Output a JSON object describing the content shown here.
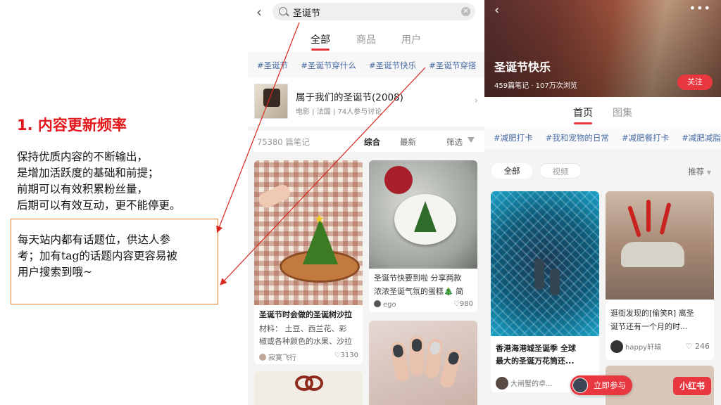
{
  "slide": {
    "heading": "1. 内容更新频率",
    "body": [
      "保持优质内容的不断输出，",
      "是增加活跃度的基础和前提；",
      "前期可以有效积累粉丝量，",
      "后期可以有效互动，更不能停更。"
    ],
    "callout": [
      "每天站内都有话题位，供达人参",
      "考；加有tag的话题内容更容易被",
      "用户搜索到哦~"
    ]
  },
  "search_screen": {
    "query": "圣诞节",
    "tabs": [
      {
        "label": "全部",
        "active": true
      },
      {
        "label": "商品",
        "active": false
      },
      {
        "label": "用户",
        "active": false
      }
    ],
    "hashtags": [
      "#圣诞节",
      "#圣诞节穿什么",
      "#圣诞节快乐",
      "#圣诞节穿搭"
    ],
    "topic": {
      "title": "属于我们的圣诞节(2008)",
      "meta": "电影 | 法国 | 74人参与讨论"
    },
    "note_count": "75380 篇笔记",
    "sort_options": [
      "综合",
      "最新"
    ],
    "filter_label": "筛选",
    "cards": [
      {
        "title": "圣诞节时会做的圣诞树沙拉",
        "desc_line1": "材料：  土豆、西兰花、彩",
        "desc_line2": "椒或各种颜色的水果、沙拉",
        "author": "寂寞飞行",
        "likes": "3130"
      },
      {
        "title_line1": "圣诞节快要到啦 分享两款",
        "title_line2": "浓浓圣诞气氛的蛋糕🎄 简",
        "author": "ego",
        "likes": "980"
      }
    ]
  },
  "topic_screen": {
    "title": "圣诞节快乐",
    "meta": "459篇笔记 · 107万次浏览",
    "follow_label": "关注",
    "tabs": [
      {
        "label": "首页",
        "active": true
      },
      {
        "label": "图集",
        "active": false
      }
    ],
    "hashtags": [
      "#减肥打卡",
      "#我和宠物的日常",
      "#减肥餐打卡",
      "#减肥减脂"
    ],
    "filter_chips": [
      "全部",
      "视频"
    ],
    "sort_label": "推荐",
    "cards": [
      {
        "title_line1": "香港海港城圣诞季 全球",
        "title_line2": "最大的圣诞万花筒还...",
        "author": "大闸蟹的卓..."
      },
      {
        "title_line1": "逛街发现的[偷笑R] 离圣",
        "title_line2": "诞节还有一个月的时...",
        "author": "happy轩辕",
        "likes": "246"
      }
    ],
    "join_label": "立即参与",
    "brand": "小红书"
  },
  "colors": {
    "accent": "#e8373f",
    "heading_red": "#e3161b",
    "hashtag_blue": "#4a6da6",
    "callout_border": "#e07a2a"
  }
}
